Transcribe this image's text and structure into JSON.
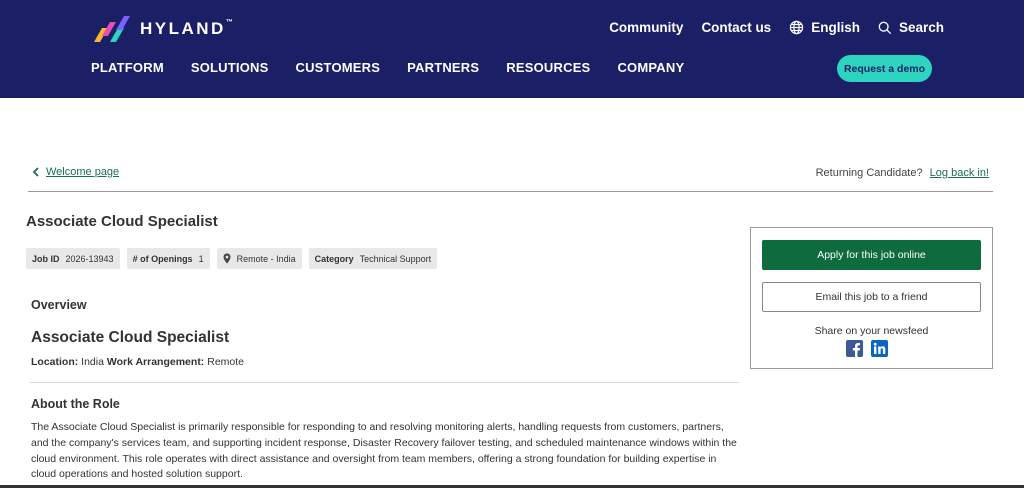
{
  "header": {
    "brand": "HYLAND",
    "brand_tm": "™",
    "util": {
      "community": "Community",
      "contact": "Contact us",
      "language": "English",
      "search": "Search"
    },
    "nav": [
      "PLATFORM",
      "SOLUTIONS",
      "CUSTOMERS",
      "PARTNERS",
      "RESOURCES",
      "COMPANY"
    ],
    "demo_label": "Request a demo"
  },
  "subheader": {
    "welcome_label": "Welcome page",
    "returning_text": "Returning Candidate?",
    "login_label": "Log back in!"
  },
  "job": {
    "title": "Associate Cloud Specialist",
    "tags": {
      "job_id_key": "Job ID",
      "job_id_val": "2026-13943",
      "openings_key": "# of Openings",
      "openings_val": "1",
      "location_val": "Remote - India",
      "category_key": "Category",
      "category_val": "Technical Support"
    },
    "overview_heading": "Overview",
    "role_heading": "Associate Cloud Specialist",
    "location_key": "Location:",
    "location_val": "India",
    "arrangement_key": "Work Arrangement:",
    "arrangement_val": "Remote",
    "about_heading": "About the Role",
    "about_text": "The Associate Cloud Specialist is primarily responsible for responding to and resolving monitoring alerts, handling requests from customers, partners, and the company's services team, and supporting incident response, Disaster Recovery failover testing, and scheduled maintenance windows within the cloud environment. This role operates with direct assistance and oversight from team members, offering a strong foundation for building expertise in cloud operations and hosted solution support."
  },
  "sidebox": {
    "apply_label": "Apply for this job online",
    "email_label": "Email this job to a friend",
    "share_label": "Share on your newsfeed",
    "social": [
      "facebook-icon",
      "linkedin-icon"
    ]
  },
  "colors": {
    "header_bg": "#1a1f66",
    "demo_btn": "#2dd4bf",
    "apply_btn": "#0d6b3d",
    "link": "#1b6f4e"
  }
}
